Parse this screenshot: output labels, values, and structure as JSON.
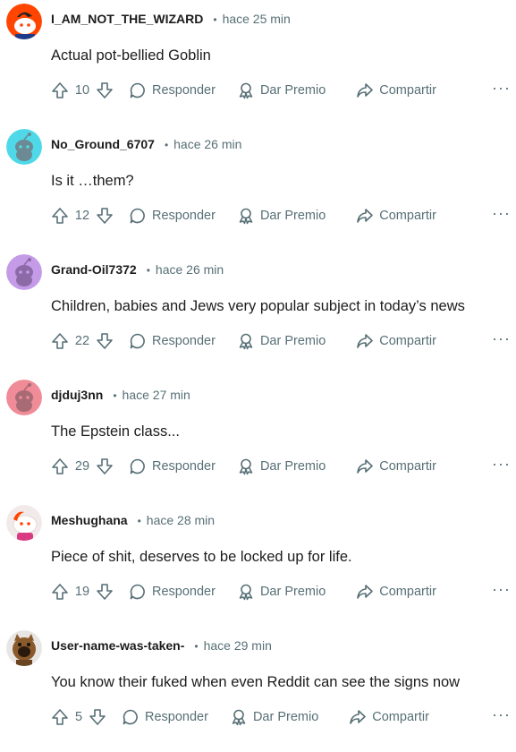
{
  "labels": {
    "reply": "Responder",
    "award": "Dar Premio",
    "share": "Compartir",
    "dot": "•"
  },
  "colors": {
    "meta": "#576f76",
    "text": "#1c1c1c"
  },
  "comments": [
    {
      "username": "I_AM_NOT_THE_WIZARD",
      "time": "hace 25 min",
      "body": "Actual pot-bellied Goblin",
      "votes": "10",
      "avatar_bg": "#ff4500"
    },
    {
      "username": "No_Ground_6707",
      "time": "hace 26 min",
      "body": "Is it …them?",
      "votes": "12",
      "avatar_bg": "#4fd9e8"
    },
    {
      "username": "Grand-Oil7372",
      "time": "hace 26 min",
      "body": "Children, babies and Jews very popular subject in today’s news",
      "votes": "22",
      "avatar_bg": "#c59be8"
    },
    {
      "username": "djduj3nn",
      "time": "hace 27 min",
      "body": "The Epstein class...",
      "votes": "29",
      "avatar_bg": "#f08b98"
    },
    {
      "username": "Meshughana",
      "time": "hace 28 min",
      "body": "Piece of shit, deserves to be locked up for life.",
      "votes": "19",
      "avatar_bg": "#f2eaea"
    },
    {
      "username": "User-name-was-taken-",
      "time": "hace 29 min",
      "body": "You know their fuked when even Reddit can see the signs now",
      "votes": "5",
      "avatar_bg": "#e8e6e4"
    }
  ]
}
